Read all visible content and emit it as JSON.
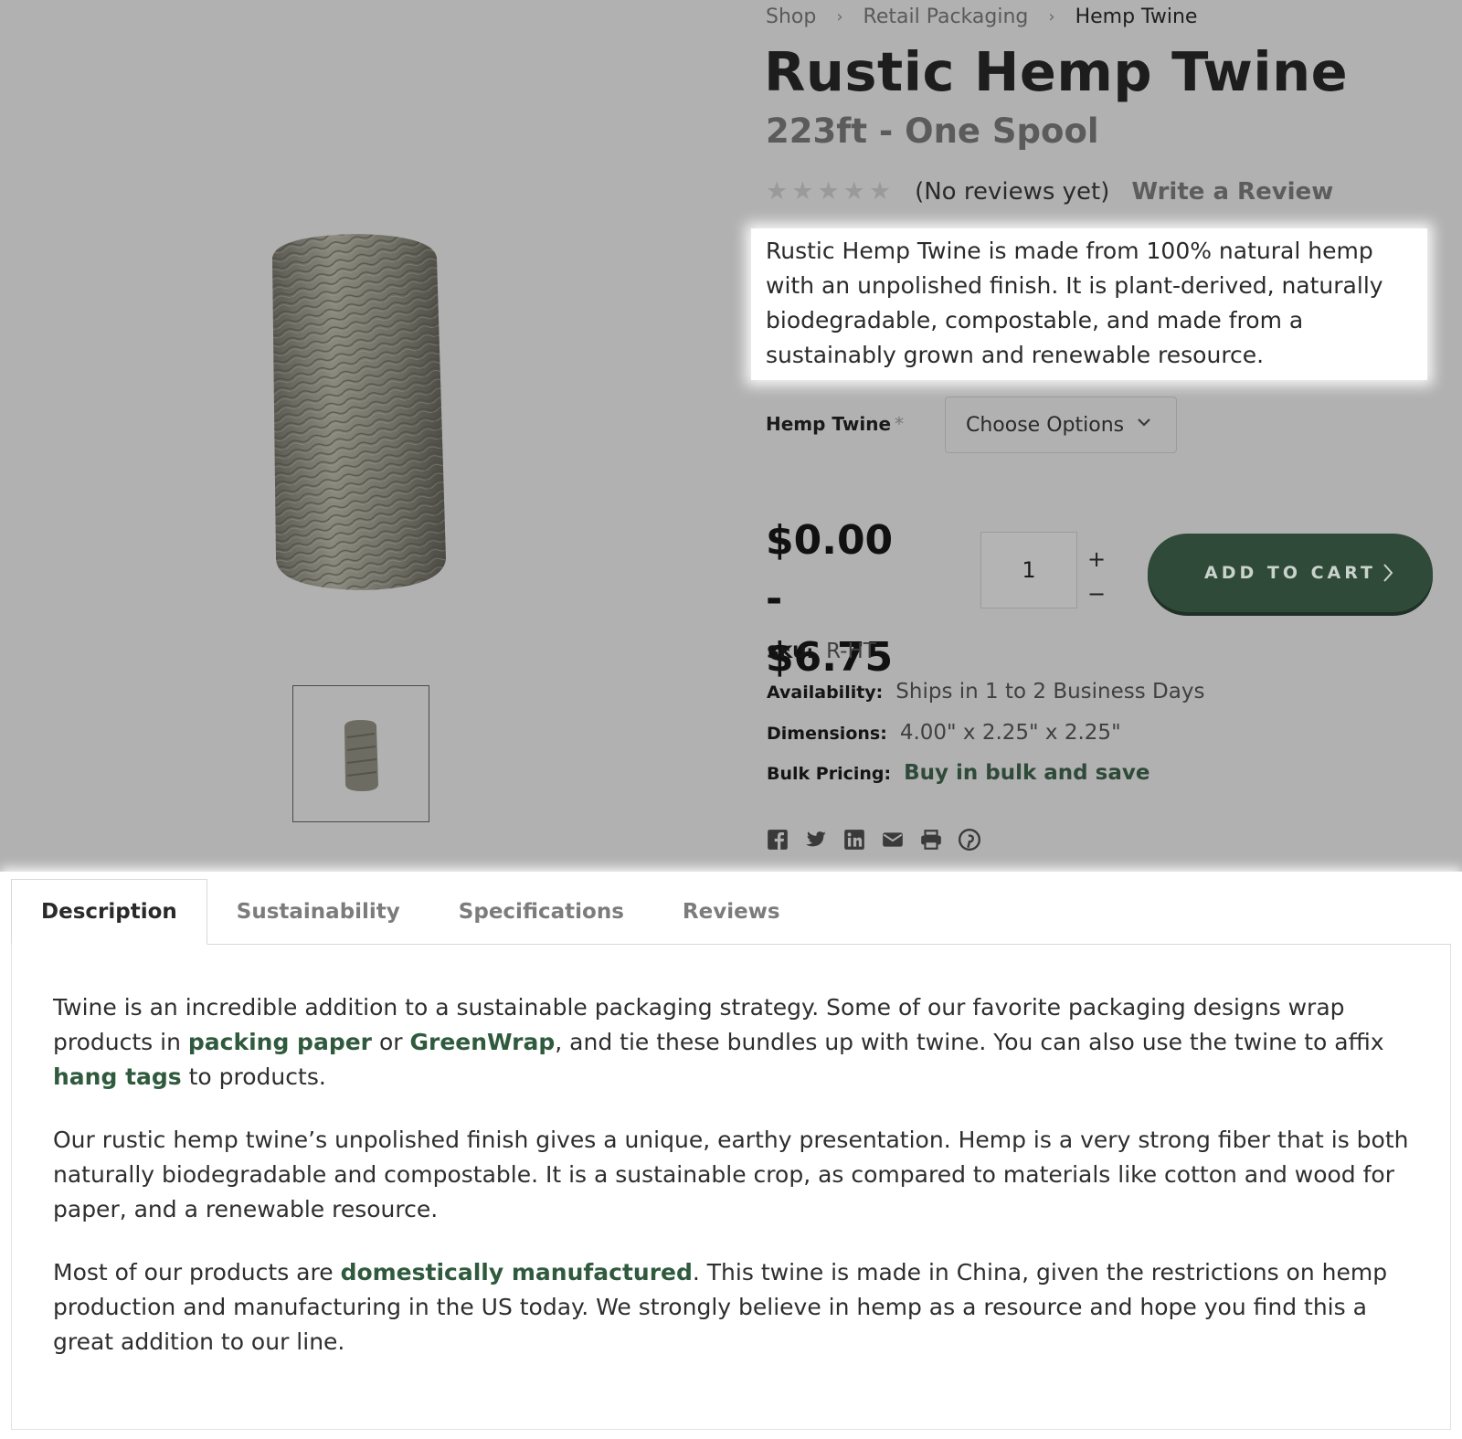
{
  "breadcrumb": {
    "items": [
      "Shop",
      "Retail Packaging",
      "Hemp Twine"
    ],
    "separator": "›"
  },
  "product": {
    "title": "Rustic Hemp Twine",
    "subtitle": "223ft - One Spool",
    "rating": {
      "stars": 0,
      "max": 5,
      "reviews_text": "(No reviews yet)",
      "write_review": "Write a Review"
    },
    "summary": "Rustic Hemp Twine is made from 100% natural hemp with an unpolished finish. It is plant-derived, naturally biodegradable, compostable, and made from a sustainably grown and renewable resource.",
    "option": {
      "label": "Hemp Twine",
      "required_mark": "*",
      "selected": "Choose Options"
    },
    "price_line1": "$0.00 -",
    "price_line2": "$6.75",
    "quantity": "1",
    "qty_inc": "+",
    "qty_dec": "−",
    "add_to_cart": "ADD TO CART",
    "meta": {
      "sku_label": "SKU:",
      "sku": "R-HT",
      "availability_label": "Availability:",
      "availability": "Ships in 1 to 2 Business Days",
      "dimensions_label": "Dimensions:",
      "dimensions": "4.00\" x 2.25\" x 2.25\"",
      "bulk_label": "Bulk Pricing:",
      "bulk": "Buy in bulk and save"
    },
    "share_icons": [
      "facebook-icon",
      "twitter-icon",
      "linkedin-icon",
      "email-icon",
      "print-icon",
      "pinterest-icon"
    ]
  },
  "tabs": {
    "items": [
      "Description",
      "Sustainability",
      "Specifications",
      "Reviews"
    ],
    "active": "Description"
  },
  "description": {
    "p1": {
      "t1": "Twine is an incredible addition to a sustainable packaging strategy. Some of our favorite packaging designs wrap products in ",
      "link1": "packing paper",
      "t2": " or ",
      "link2": "GreenWrap",
      "t3": ", and tie these bundles up with twine. You can also use the twine to affix ",
      "link3": "hang tags",
      "t4": " to products."
    },
    "p2": "Our rustic hemp twine’s unpolished finish gives a unique, earthy presentation. Hemp is a very strong fiber that is both naturally biodegradable and compostable. It is a sustainable crop, as compared to materials like cotton and wood for paper, and a renewable resource.",
    "p3": {
      "t1": "Most of our products are ",
      "link1": "domestically manufactured",
      "t2": ". This twine is made in China, given the restrictions on hemp production and manufacturing in the US today. We strongly believe in hemp as a resource and hope you find this a great addition to our line."
    }
  },
  "colors": {
    "page_bg": "#b1b1b1",
    "brand_green": "#2f4a39",
    "link_green": "#2f5a3d"
  }
}
